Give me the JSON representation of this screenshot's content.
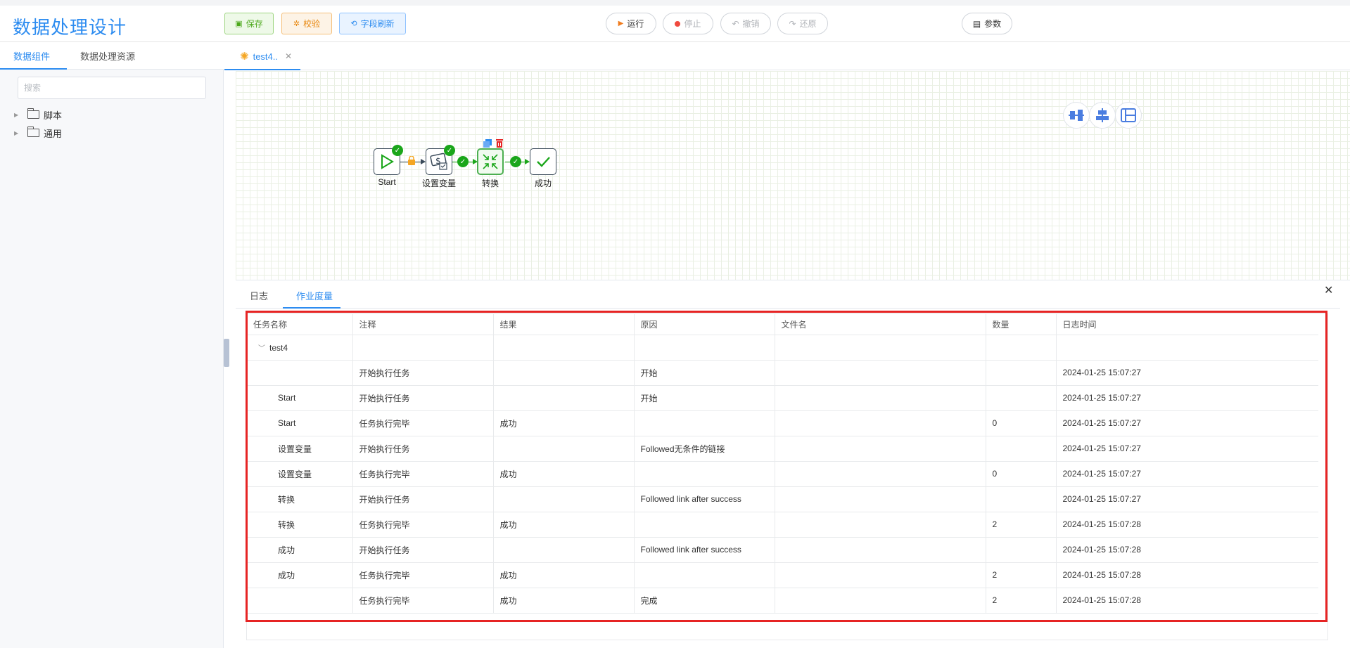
{
  "app": {
    "title": "数据处理设计"
  },
  "toolbar": {
    "save": "保存",
    "check": "校验",
    "refresh": "字段刷新",
    "run": "运行",
    "stop": "停止",
    "undo": "撤销",
    "redo": "还原",
    "params": "参数"
  },
  "left": {
    "tabs": [
      "数据组件",
      "数据处理资源"
    ],
    "search_placeholder": "搜索",
    "tree": [
      "脚本",
      "通用"
    ]
  },
  "editor": {
    "tab_label": "test4..",
    "nodes": {
      "start": "Start",
      "setvar": "设置变量",
      "convert": "转换",
      "success": "成功"
    }
  },
  "bottom": {
    "tabs": [
      "日志",
      "作业度量"
    ],
    "headers": [
      "任务名称",
      "注释",
      "结果",
      "原因",
      "文件名",
      "数量",
      "日志时间"
    ],
    "group": "test4",
    "rows": [
      [
        "",
        "开始执行任务",
        "",
        "开始",
        "",
        "",
        "2024-01-25 15:07:27"
      ],
      [
        "Start",
        "开始执行任务",
        "",
        "开始",
        "",
        "",
        "2024-01-25 15:07:27"
      ],
      [
        "Start",
        "任务执行完毕",
        "成功",
        "",
        "",
        "0",
        "2024-01-25 15:07:27"
      ],
      [
        "设置变量",
        "开始执行任务",
        "",
        "Followed无条件的链接",
        "",
        "",
        "2024-01-25 15:07:27"
      ],
      [
        "设置变量",
        "任务执行完毕",
        "成功",
        "",
        "",
        "0",
        "2024-01-25 15:07:27"
      ],
      [
        "转换",
        "开始执行任务",
        "",
        "Followed link after success",
        "",
        "",
        "2024-01-25 15:07:27"
      ],
      [
        "转换",
        "任务执行完毕",
        "成功",
        "",
        "",
        "2",
        "2024-01-25 15:07:28"
      ],
      [
        "成功",
        "开始执行任务",
        "",
        "Followed link after success",
        "",
        "",
        "2024-01-25 15:07:28"
      ],
      [
        "成功",
        "任务执行完毕",
        "成功",
        "",
        "",
        "2",
        "2024-01-25 15:07:28"
      ],
      [
        "",
        "任务执行完毕",
        "成功",
        "完成",
        "",
        "2",
        "2024-01-25 15:07:28"
      ]
    ]
  }
}
